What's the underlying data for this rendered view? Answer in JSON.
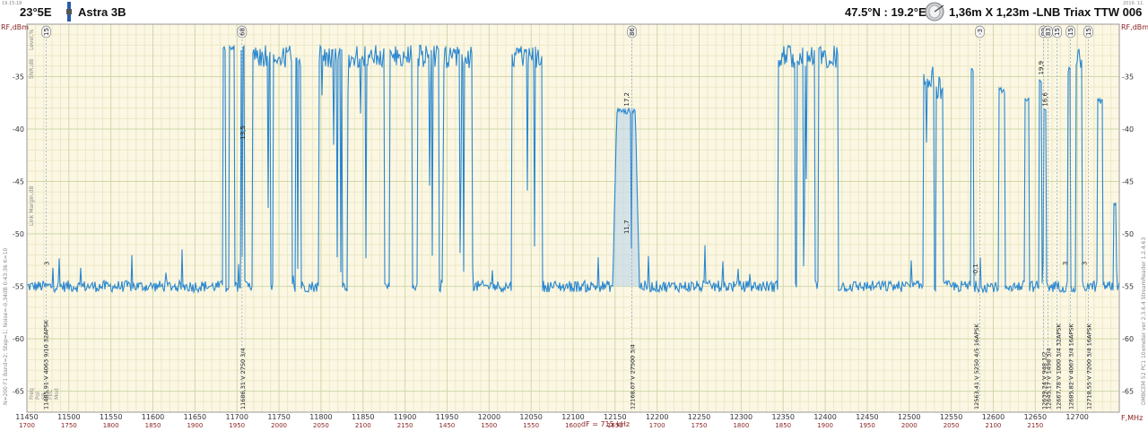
{
  "header": {
    "position": "23°5E",
    "satellite": "Astra 3B",
    "location": "47.5°N : 19.2°E",
    "antenna": "1,36m X 1,23m -LNB Triax TTW 006",
    "corner_left": "19.15:18",
    "corner_right": "2019. 11."
  },
  "chart_data": {
    "type": "line",
    "title": "",
    "ylabel": "RF,dBm",
    "xlabel": "F,MHz",
    "xlim": [
      11450,
      12750
    ],
    "ylim": [
      -67,
      -30
    ],
    "grid": true,
    "x_ticks": [
      11450,
      11500,
      11550,
      11600,
      11650,
      11700,
      11750,
      11800,
      11850,
      11900,
      11950,
      12000,
      12050,
      12100,
      12150,
      12200,
      12250,
      12300,
      12350,
      12400,
      12450,
      12500,
      12550,
      12600,
      12650,
      12700
    ],
    "if_ticks": [
      "1700",
      "1750",
      "1800",
      "1850",
      "1900",
      "1950",
      "2000",
      "2050",
      "2100",
      "2150",
      "1450",
      "1500",
      "1550",
      "1600",
      "1650",
      "1700",
      "1750",
      "1800",
      "1850",
      "1900",
      "1950",
      "2000",
      "2050",
      "2100",
      "2150"
    ],
    "y_ticks": [
      -35,
      -40,
      -45,
      -50,
      -55,
      -60,
      -65
    ],
    "left_side_labels": [
      "Level,%",
      "SNR,dB",
      "Link Margin,dB"
    ],
    "left_side_text": "N=200 F1 Band=2; Step=1; Noise=-0,34dB  0:43:36  K=10",
    "table_header": [
      "Freq",
      "Pol",
      "SR",
      "FEC",
      "Mod"
    ],
    "right_side_text": "DMBCEM 52 PC1  10xmeter ver 2.3.6.4  StreamReader 1.2.4.63",
    "df_label": "dF = 715 kHz",
    "noise_floor": -55,
    "segments": [
      {
        "start": 11718,
        "end": 11740,
        "level": -32
      },
      {
        "start": 11743,
        "end": 11765,
        "level": -32
      },
      {
        "start": 11770,
        "end": 11776,
        "level": -33
      },
      {
        "start": 11797,
        "end": 11825,
        "level": -32
      },
      {
        "start": 11832,
        "end": 11875,
        "level": -32
      },
      {
        "start": 11882,
        "end": 11908,
        "level": -32
      },
      {
        "start": 11915,
        "end": 11940,
        "level": -32
      },
      {
        "start": 11945,
        "end": 11980,
        "level": -32
      },
      {
        "start": 12027,
        "end": 12063,
        "level": -32
      },
      {
        "start": 12344,
        "end": 12364,
        "level": -32
      },
      {
        "start": 12366,
        "end": 12388,
        "level": -32
      },
      {
        "start": 12392,
        "end": 12415,
        "level": -32
      },
      {
        "start": 12517,
        "end": 12530,
        "level": -34
      },
      {
        "start": 12532,
        "end": 12540,
        "level": -35
      },
      {
        "start": 12698,
        "end": 12706,
        "level": -32
      }
    ],
    "carriers": [
      {
        "freq": 11685,
        "level": -32,
        "width": 3
      },
      {
        "freq": 11694,
        "level": -32,
        "width": 6
      },
      {
        "freq": 11707,
        "level": -32,
        "width": 4
      },
      {
        "freq": 12163,
        "level": -38,
        "width": 32,
        "label_top": "17,2",
        "label_mid": "11,7"
      },
      {
        "freq": 12656,
        "level": -35,
        "width": 3,
        "label_top": "19,9"
      },
      {
        "freq": 12661,
        "level": -38,
        "width": 3,
        "label_top": "16,6"
      },
      {
        "freq": 12690,
        "level": -34,
        "width": 3
      },
      {
        "freq": 12727,
        "level": -37,
        "width": 7
      },
      {
        "freq": 12745,
        "level": -47,
        "width": 3
      },
      {
        "freq": 12610,
        "level": -36,
        "width": 8
      },
      {
        "freq": 12575,
        "level": -34,
        "width": 3
      },
      {
        "freq": 12640,
        "level": -37,
        "width": 6
      }
    ],
    "top_badges": [
      {
        "freq": 11473,
        "text": "15"
      },
      {
        "freq": 11706,
        "text": "68"
      },
      {
        "freq": 12170,
        "text": "86"
      },
      {
        "freq": 12584,
        "text": "-3"
      },
      {
        "freq": 12660,
        "text": "99"
      },
      {
        "freq": 12665,
        "text": "83"
      },
      {
        "freq": 12676,
        "text": "15"
      },
      {
        "freq": 12692,
        "text": "15"
      },
      {
        "freq": 12713,
        "text": "15"
      }
    ],
    "marker_labels": [
      {
        "freq": 11706,
        "text": "13,5",
        "level": -41
      },
      {
        "freq": 11473,
        "text": "3",
        "level": -53
      },
      {
        "freq": 12685,
        "text": "3",
        "level": -53
      },
      {
        "freq": 12708,
        "text": "3",
        "level": -53
      },
      {
        "freq": 12578,
        "text": "-0,1",
        "level": -54
      }
    ],
    "transponders": [
      {
        "freq": 11472,
        "text": "11485,91  V   4063 9/10 32APSK"
      },
      {
        "freq": 11706,
        "text": "11686,31  V   2750 3/4"
      },
      {
        "freq": 12170,
        "text": "12168,07  V   27500 3/4"
      },
      {
        "freq": 12579,
        "text": "12563,41  V   5250 4/5 16APSK"
      },
      {
        "freq": 12660,
        "text": "12639,24  V   948 1/2"
      },
      {
        "freq": 12665,
        "text": "12645,17  V   1498 3/4"
      },
      {
        "freq": 12677,
        "text": "12667,78  V   1000 3/4 32APSK"
      },
      {
        "freq": 12692,
        "text": "12685,82  V   4067 3/4 16APSK"
      },
      {
        "freq": 12713,
        "text": "12718,55  V   7200 3/4 16APSK"
      }
    ]
  }
}
